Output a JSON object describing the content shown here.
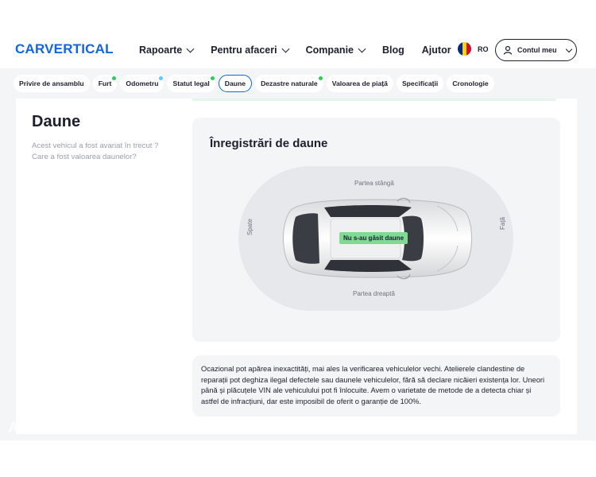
{
  "header": {
    "logo": "CARVERTICAL",
    "nav": [
      {
        "label": "Rapoarte",
        "has_dropdown": true
      },
      {
        "label": "Pentru afaceri",
        "has_dropdown": true
      },
      {
        "label": "Companie",
        "has_dropdown": true
      },
      {
        "label": "Blog",
        "has_dropdown": false
      },
      {
        "label": "Ajutor",
        "has_dropdown": false
      }
    ],
    "language": "RO",
    "account_label": "Contul meu"
  },
  "tabs": [
    {
      "label": "Privire de ansamblu",
      "dot": null
    },
    {
      "label": "Furt",
      "dot": "#34c759"
    },
    {
      "label": "Odometru",
      "dot": "#5ac8fa"
    },
    {
      "label": "Statut legal",
      "dot": "#34c759"
    },
    {
      "label": "Daune",
      "dot": null,
      "active": true
    },
    {
      "label": "Dezastre naturale",
      "dot": "#34c759"
    },
    {
      "label": "Valoarea de piață",
      "dot": null
    },
    {
      "label": "Specificații",
      "dot": null
    },
    {
      "label": "Cronologie",
      "dot": null
    }
  ],
  "section": {
    "title": "Daune",
    "subtitle": "Acest vehicul a fost avariat în trecut ? Care a fost valoarea daunelor?"
  },
  "records": {
    "title": "Înregistrări de daune",
    "label_left_side": "Partea stângă",
    "label_right_side": "Partea dreaptă",
    "label_rear": "Spate",
    "label_front": "Față",
    "status_badge": "Nu s-au găsit daune"
  },
  "notice": "Ocazional pot apărea inexactități, mai ales la verificarea vehiculelor vechi. Atelierele clandestine de reparații pot deghiza ilegal defectele sau daunele vehiculelor, fără să declare nicăieri existența lor. Uneori până și plăcuțele VIN ale vehiculului pot fi înlocuite. Avem o varietate de metode de a detecta chiar și astfel de infracțiuni, dar este imposibil de oferit o garanție de 100%.",
  "watermark": "AUTOVIT.RO",
  "colors": {
    "brand": "#1264e6",
    "badge": "#7fdb93",
    "panel": "#f4f5f7"
  }
}
